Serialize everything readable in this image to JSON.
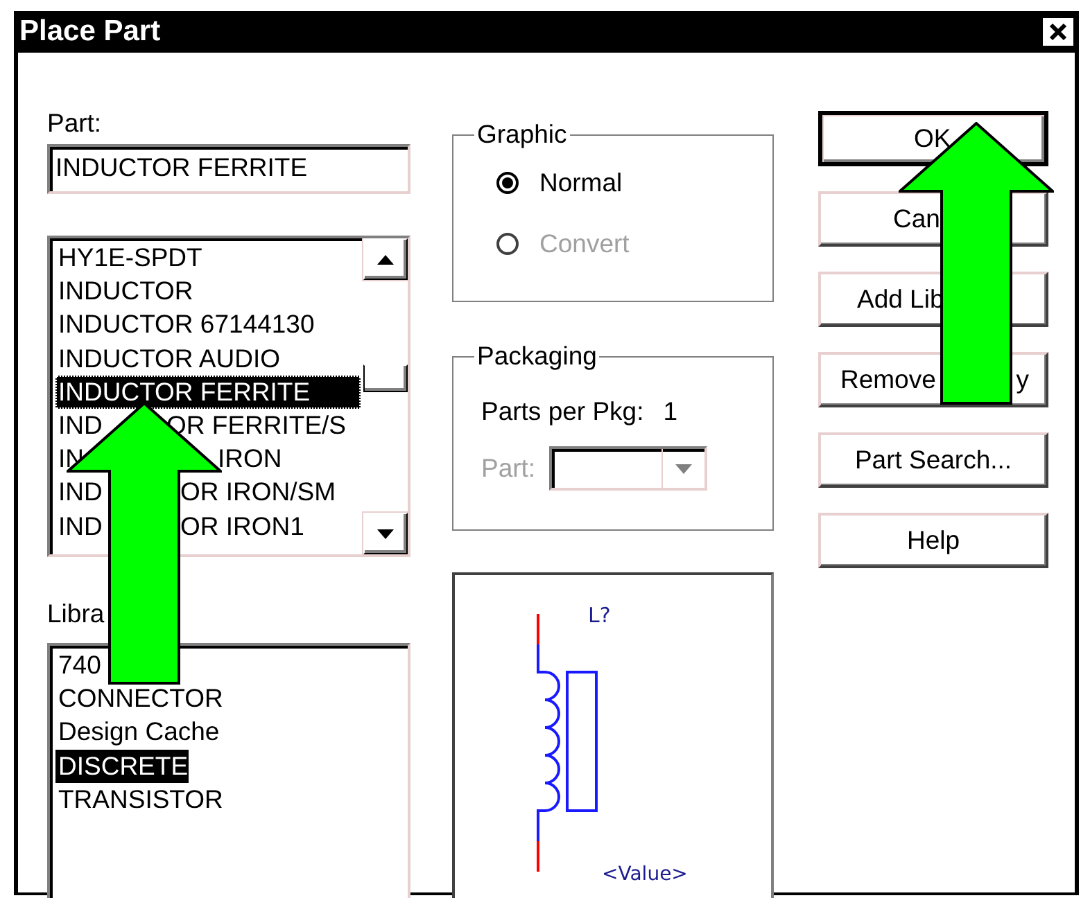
{
  "window": {
    "title": "Place Part"
  },
  "part_field": {
    "label": "Part:",
    "value": "INDUCTOR FERRITE"
  },
  "part_list": {
    "items": [
      {
        "text": "HY1E-SPDT",
        "selected": false
      },
      {
        "text": "INDUCTOR",
        "selected": false
      },
      {
        "text": "INDUCTOR 67144130",
        "selected": false
      },
      {
        "text": "INDUCTOR AUDIO",
        "selected": false
      },
      {
        "text": "INDUCTOR FERRITE",
        "selected": true
      },
      {
        "text": "IND",
        "text_right": "OR FERRITE/S",
        "selected": false
      },
      {
        "text": "IN",
        "text_right": "IRON",
        "selected": false
      },
      {
        "text": "IND",
        "text_right": "OR IRON/SM",
        "selected": false
      },
      {
        "text": "IND",
        "text_right": "OR IRON1",
        "selected": false
      }
    ]
  },
  "library": {
    "label": "Libra",
    "items": [
      {
        "text": "740",
        "selected": false
      },
      {
        "text": "CONNECTOR",
        "selected": false
      },
      {
        "text": "Design Cache",
        "selected": false
      },
      {
        "text": "DISCRETE",
        "selected": true
      },
      {
        "text": "TRANSISTOR",
        "selected": false
      }
    ]
  },
  "graphic": {
    "title": "Graphic",
    "options": [
      {
        "label": "Normal",
        "selected": true,
        "disabled": false
      },
      {
        "label": "Convert",
        "selected": false,
        "disabled": true
      }
    ]
  },
  "packaging": {
    "title": "Packaging",
    "parts_per_pkg": {
      "label": "Parts per Pkg:",
      "value": "1"
    },
    "part_select": {
      "label": "Part:",
      "disabled": true
    }
  },
  "preview": {
    "reference": "L?",
    "value": "<Value>"
  },
  "buttons": [
    {
      "label": "OK",
      "default": true
    },
    {
      "label": "Can",
      "default": false
    },
    {
      "label": "Add Lib",
      "default": false
    },
    {
      "label": "Remove",
      "text_right": "y",
      "default": false
    },
    {
      "label": "Part Search...",
      "default": false
    },
    {
      "label": "Help",
      "default": false
    }
  ]
}
